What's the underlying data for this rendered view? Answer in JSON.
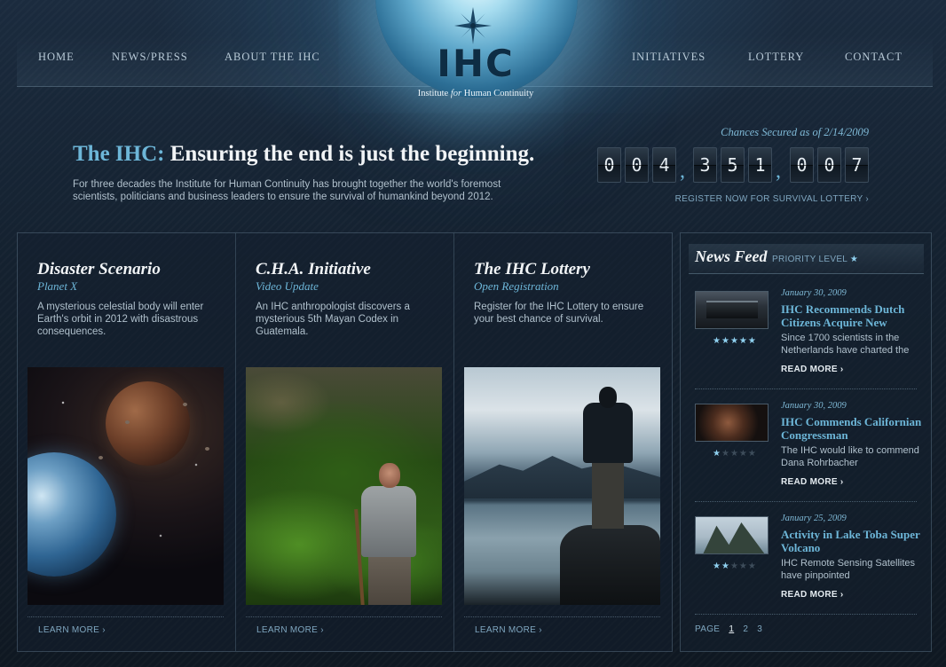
{
  "nav": {
    "left": [
      "HOME",
      "NEWS/PRESS",
      "ABOUT THE IHC"
    ],
    "right": [
      "INITIATIVES",
      "LOTTERY",
      "CONTACT"
    ]
  },
  "logo": {
    "text": "IHC",
    "tagline_pre": "Institute ",
    "tagline_for": "for",
    "tagline_post": " Human Continuity"
  },
  "hero": {
    "title_accent": "The IHC:",
    "title_rest": " Ensuring the end is just the beginning.",
    "description": "For three decades the Institute for Human Continuity has brought together the world's foremost scientists, politicians and business leaders to ensure the survival of humankind beyond 2012."
  },
  "counter": {
    "label": "Chances Secured as of 2/14/2009",
    "digits": [
      "0",
      "0",
      "4",
      "3",
      "5",
      "1",
      "0",
      "0",
      "7"
    ],
    "separator": ",",
    "register_link": "REGISTER NOW FOR SURVIVAL LOTTERY"
  },
  "features": [
    {
      "title": "Disaster Scenario",
      "subtitle": "Planet X",
      "text": "A mysterious celestial body will enter Earth's orbit in 2012 with disastrous consequences.",
      "link": "LEARN MORE"
    },
    {
      "title": "C.H.A. Initiative",
      "subtitle": "Video Update",
      "text": "An IHC anthropologist discovers a mysterious 5th Mayan Codex in Guatemala.",
      "link": "LEARN MORE"
    },
    {
      "title": "The IHC Lottery",
      "subtitle": "Open Registration",
      "text": "Register for the IHC Lottery to ensure your best chance of survival.",
      "link": "LEARN MORE"
    }
  ],
  "news": {
    "title": "News Feed",
    "priority_label": "PRIORITY LEVEL",
    "items": [
      {
        "date": "January 30, 2009",
        "headline": "IHC Recommends Dutch Citizens Acquire New",
        "text": "Since 1700 scientists in the Netherlands have charted the",
        "read_more": "READ MORE",
        "priority": 5
      },
      {
        "date": "January 30, 2009",
        "headline": "IHC Commends Californian Congressman",
        "text": "The IHC would like to commend Dana Rohrbacher",
        "read_more": "READ MORE",
        "priority": 1
      },
      {
        "date": "January 25, 2009",
        "headline": "Activity in Lake Toba Super Volcano",
        "text": "IHC Remote Sensing Satellites have pinpointed",
        "read_more": "READ MORE",
        "priority": 2
      }
    ],
    "pager": {
      "label": "PAGE",
      "pages": [
        "1",
        "2",
        "3"
      ],
      "current": "1"
    }
  },
  "colors": {
    "accent": "#6db6d8",
    "background": "#14212f",
    "text": "#b0c0cc"
  }
}
